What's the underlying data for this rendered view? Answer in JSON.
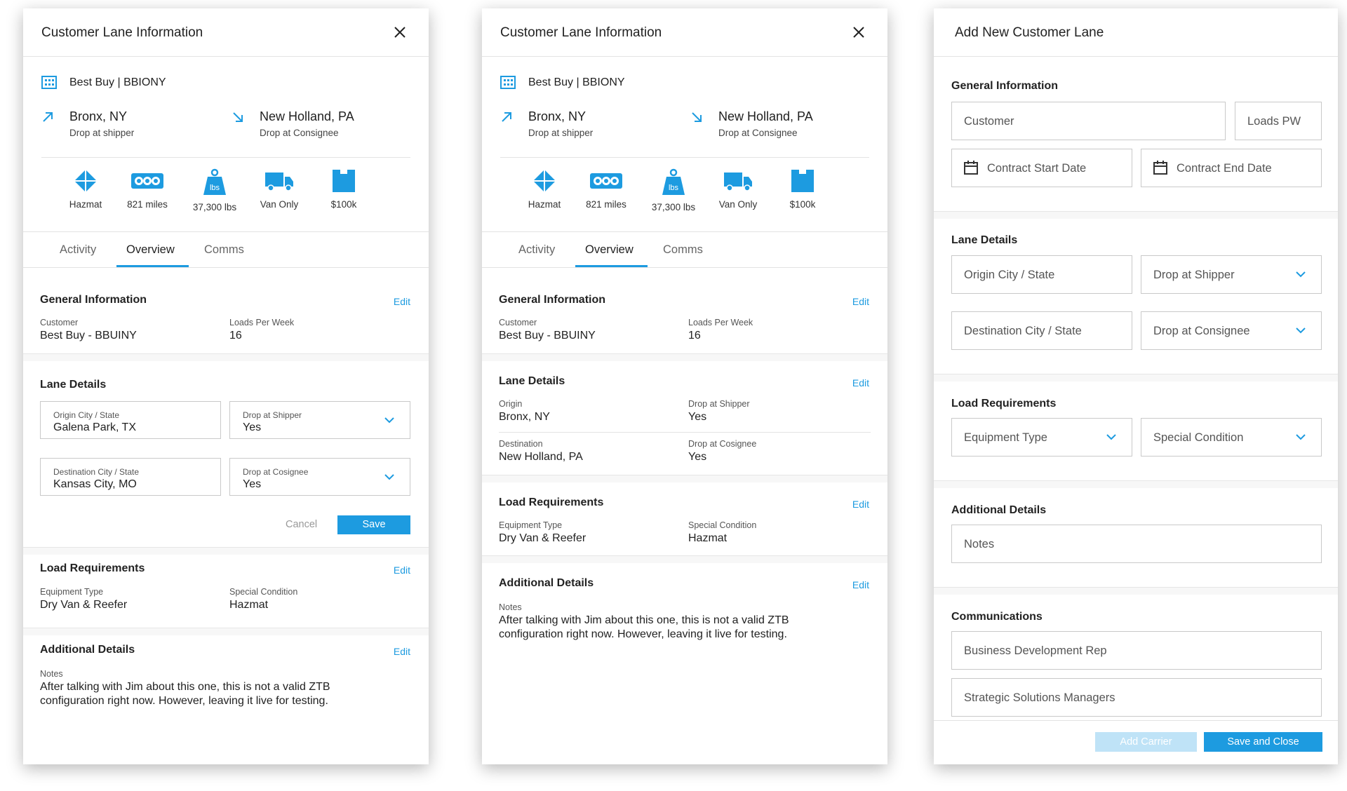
{
  "colors": {
    "accent": "#1d9be0",
    "border": "#c9c9c9",
    "muted": "#666666"
  },
  "icons": {
    "close": "close-icon",
    "building": "building-icon",
    "pickup": "arrow-up-right-icon",
    "dropoff": "arrow-down-right-icon",
    "hazmat": "hazmat-diamond-icon",
    "miles": "odometer-icon",
    "weight": "weight-icon",
    "truck": "truck-icon",
    "value": "value-box-icon",
    "chevron": "chevron-down-icon",
    "calendar": "calendar-icon"
  },
  "panel1": {
    "title": "Customer Lane Information",
    "customer": "Best Buy | BBIONY",
    "origin": {
      "city": "Bronx, NY",
      "sub": "Drop at shipper"
    },
    "destination": {
      "city": "New Holland, PA",
      "sub": "Drop at Consignee"
    },
    "stats": [
      {
        "label": "Hazmat"
      },
      {
        "label": "821 miles"
      },
      {
        "label": "37,300 lbs"
      },
      {
        "label": "Van Only"
      },
      {
        "label": "$100k"
      }
    ],
    "tabs": [
      {
        "label": "Activity"
      },
      {
        "label": "Overview"
      },
      {
        "label": "Comms"
      }
    ],
    "general": {
      "title": "General Information",
      "edit": "Edit",
      "customer_label": "Customer",
      "customer_value": "Best Buy - BBUINY",
      "loads_label": "Loads Per Week",
      "loads_value": "16"
    },
    "lane": {
      "title": "Lane Details",
      "origin_label": "Origin City / State",
      "origin_value": "Galena Park, TX",
      "drop_shipper_label": "Drop at Shipper",
      "drop_shipper_value": "Yes",
      "dest_label": "Destination City / State",
      "dest_value": "Kansas City, MO",
      "drop_consignee_label": "Drop at Cosignee",
      "drop_consignee_value": "Yes",
      "cancel": "Cancel",
      "save": "Save"
    },
    "load": {
      "title": "Load Requirements",
      "edit": "Edit",
      "equip_label": "Equipment Type",
      "equip_value": "Dry Van & Reefer",
      "special_label": "Special Condition",
      "special_value": "Hazmat"
    },
    "additional": {
      "title": "Additional Details",
      "edit": "Edit",
      "notes_label": "Notes",
      "notes_value": "After talking with Jim about this one, this is not a valid ZTB configuration right now. However, leaving it live for testing."
    }
  },
  "panel2": {
    "title": "Customer Lane Information",
    "customer": "Best Buy | BBIONY",
    "origin": {
      "city": "Bronx, NY",
      "sub": "Drop at shipper"
    },
    "destination": {
      "city": "New Holland, PA",
      "sub": "Drop at Consignee"
    },
    "stats": [
      {
        "label": "Hazmat"
      },
      {
        "label": "821 miles"
      },
      {
        "label": "37,300 lbs"
      },
      {
        "label": "Van Only"
      },
      {
        "label": "$100k"
      }
    ],
    "tabs": [
      {
        "label": "Activity"
      },
      {
        "label": "Overview"
      },
      {
        "label": "Comms"
      }
    ],
    "general": {
      "title": "General Information",
      "edit": "Edit",
      "customer_label": "Customer",
      "customer_value": "Best Buy - BBUINY",
      "loads_label": "Loads Per Week",
      "loads_value": "16"
    },
    "lane": {
      "title": "Lane Details",
      "edit": "Edit",
      "origin_label": "Origin",
      "origin_value": "Bronx, NY",
      "drop_shipper_label": "Drop at Shipper",
      "drop_shipper_value": "Yes",
      "dest_label": "Destination",
      "dest_value": "New Holland, PA",
      "drop_consignee_label": "Drop at Cosignee",
      "drop_consignee_value": "Yes"
    },
    "load": {
      "title": "Load Requirements",
      "edit": "Edit",
      "equip_label": "Equipment Type",
      "equip_value": "Dry Van & Reefer",
      "special_label": "Special Condition",
      "special_value": "Hazmat"
    },
    "additional": {
      "title": "Additional Details",
      "edit": "Edit",
      "notes_label": "Notes",
      "notes_value": "After talking with Jim about this one, this is not a valid ZTB configuration right now. However, leaving it live for testing."
    }
  },
  "panel3": {
    "title": "Add New Customer Lane",
    "general": {
      "title": "General Information",
      "customer_ph": "Customer",
      "loads_ph": "Loads PW",
      "start_ph": "Contract Start Date",
      "end_ph": "Contract End Date"
    },
    "lane": {
      "title": "Lane Details",
      "origin_ph": "Origin City / State",
      "drop_shipper_ph": "Drop at Shipper",
      "dest_ph": "Destination City / State",
      "drop_consignee_ph": "Drop at Consignee"
    },
    "load": {
      "title": "Load Requirements",
      "equip_ph": "Equipment Type",
      "special_ph": "Special Condition"
    },
    "additional": {
      "title": "Additional Details",
      "notes_ph": "Notes"
    },
    "comms": {
      "title": "Communications",
      "bdr_ph": "Business Development Rep",
      "ssm_ph": "Strategic Solutions Managers"
    },
    "buttons": {
      "add_carrier": "Add Carrier",
      "save_close": "Save and Close"
    }
  }
}
